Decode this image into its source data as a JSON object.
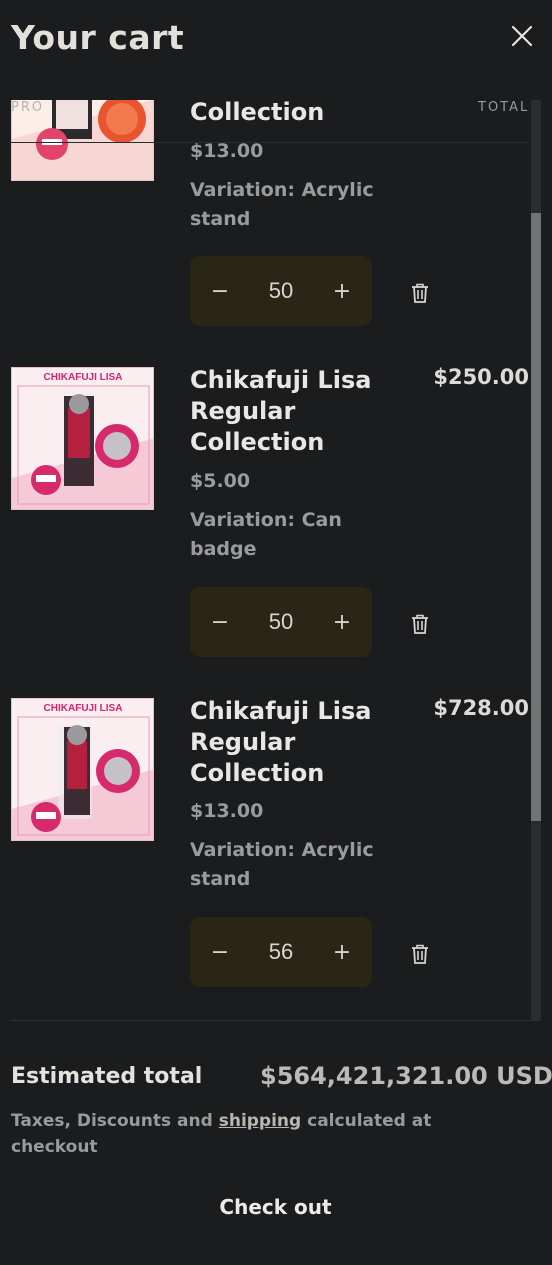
{
  "header": {
    "title": "Your cart",
    "close_label": "×"
  },
  "table": {
    "total_column_label": "TOTAL",
    "watermark_text": "PRO"
  },
  "items": [
    {
      "name": "Collection",
      "unit_price": "$13.00",
      "variation": "Variation: Acrylic stand",
      "quantity": "50",
      "line_total": "",
      "image_banner": ""
    },
    {
      "name": "Chikafuji Lisa Regular Collection",
      "unit_price": "$5.00",
      "variation": "Variation: Can badge",
      "quantity": "50",
      "line_total": "$250.00",
      "image_banner": "CHIKAFUJI LISA"
    },
    {
      "name": "Chikafuji Lisa Regular Collection",
      "unit_price": "$13.00",
      "variation": "Variation: Acrylic stand",
      "quantity": "56",
      "line_total": "$728.00",
      "image_banner": "CHIKAFUJI LISA"
    }
  ],
  "quantity_controls": {
    "minus": "−",
    "plus": "+"
  },
  "footer": {
    "estimated_label": "Estimated total",
    "estimated_value": "$564,421,321.00 USD",
    "tax_prefix": "Taxes, Discounts and ",
    "tax_link": "shipping",
    "tax_suffix": " calculated at checkout",
    "checkout_label": "Check out"
  },
  "colors": {
    "background": "#1b1c1e",
    "quantity_box": "#2a2616",
    "banner_pink": "#d6246f"
  },
  "scrollbar": {
    "position_fraction": 0.33
  }
}
